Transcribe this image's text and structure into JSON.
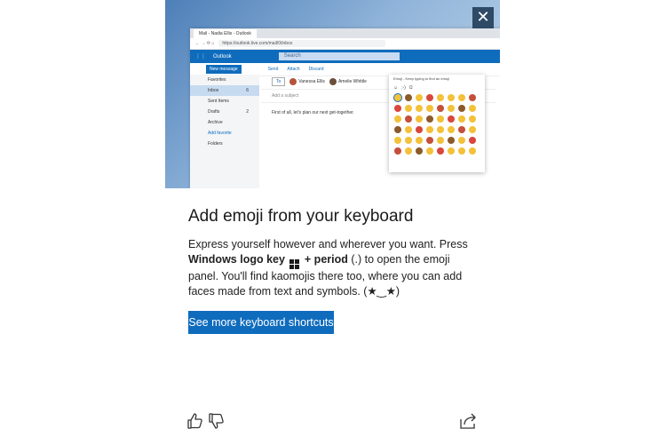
{
  "dialog": {
    "close_label": "✕",
    "title": "Add emoji from your keyboard",
    "desc_part1": "Express yourself however and wherever you want. Press",
    "desc_bold": "Windows logo key",
    "desc_plus": "+ period",
    "desc_part2": " (.) to open the emoji panel. You'll find kaomojis there too, where you can add faces made from text and symbols. (★‿★)",
    "cta_label": "See more keyboard shortcuts",
    "icons": [
      "thumbs-up-icon",
      "thumbs-down-icon",
      "share-icon",
      "close-icon",
      "windows-logo-icon"
    ]
  },
  "screenshot": {
    "tab_title": "Mail - Nadia Ellis - Outlook",
    "url": "https://outlook.live.com/mail/0/inbox",
    "app_name": "Outlook",
    "search_placeholder": "Search",
    "new_message": "New message",
    "cmd_send": "Send",
    "cmd_attach": "Attach",
    "cmd_discard": "Discard",
    "folders": [
      {
        "label": "Favorites",
        "count": ""
      },
      {
        "label": "Inbox",
        "count": "6"
      },
      {
        "label": "Sent Items",
        "count": ""
      },
      {
        "label": "Drafts",
        "count": "2"
      },
      {
        "label": "Archive",
        "count": ""
      },
      {
        "label": "Add favorite",
        "count": ""
      },
      {
        "label": "Folders",
        "count": ""
      }
    ],
    "to_label": "To",
    "recipient1": "Vanessa Ellis",
    "recipient2": "Amelie Whittle",
    "subject_placeholder": "Add a subject",
    "body": "First of all, let's plan our next get-together.",
    "emoji_panel_header": "Emoji - Keep typing to find an emoji",
    "accent_color": "#0f6cbd"
  }
}
